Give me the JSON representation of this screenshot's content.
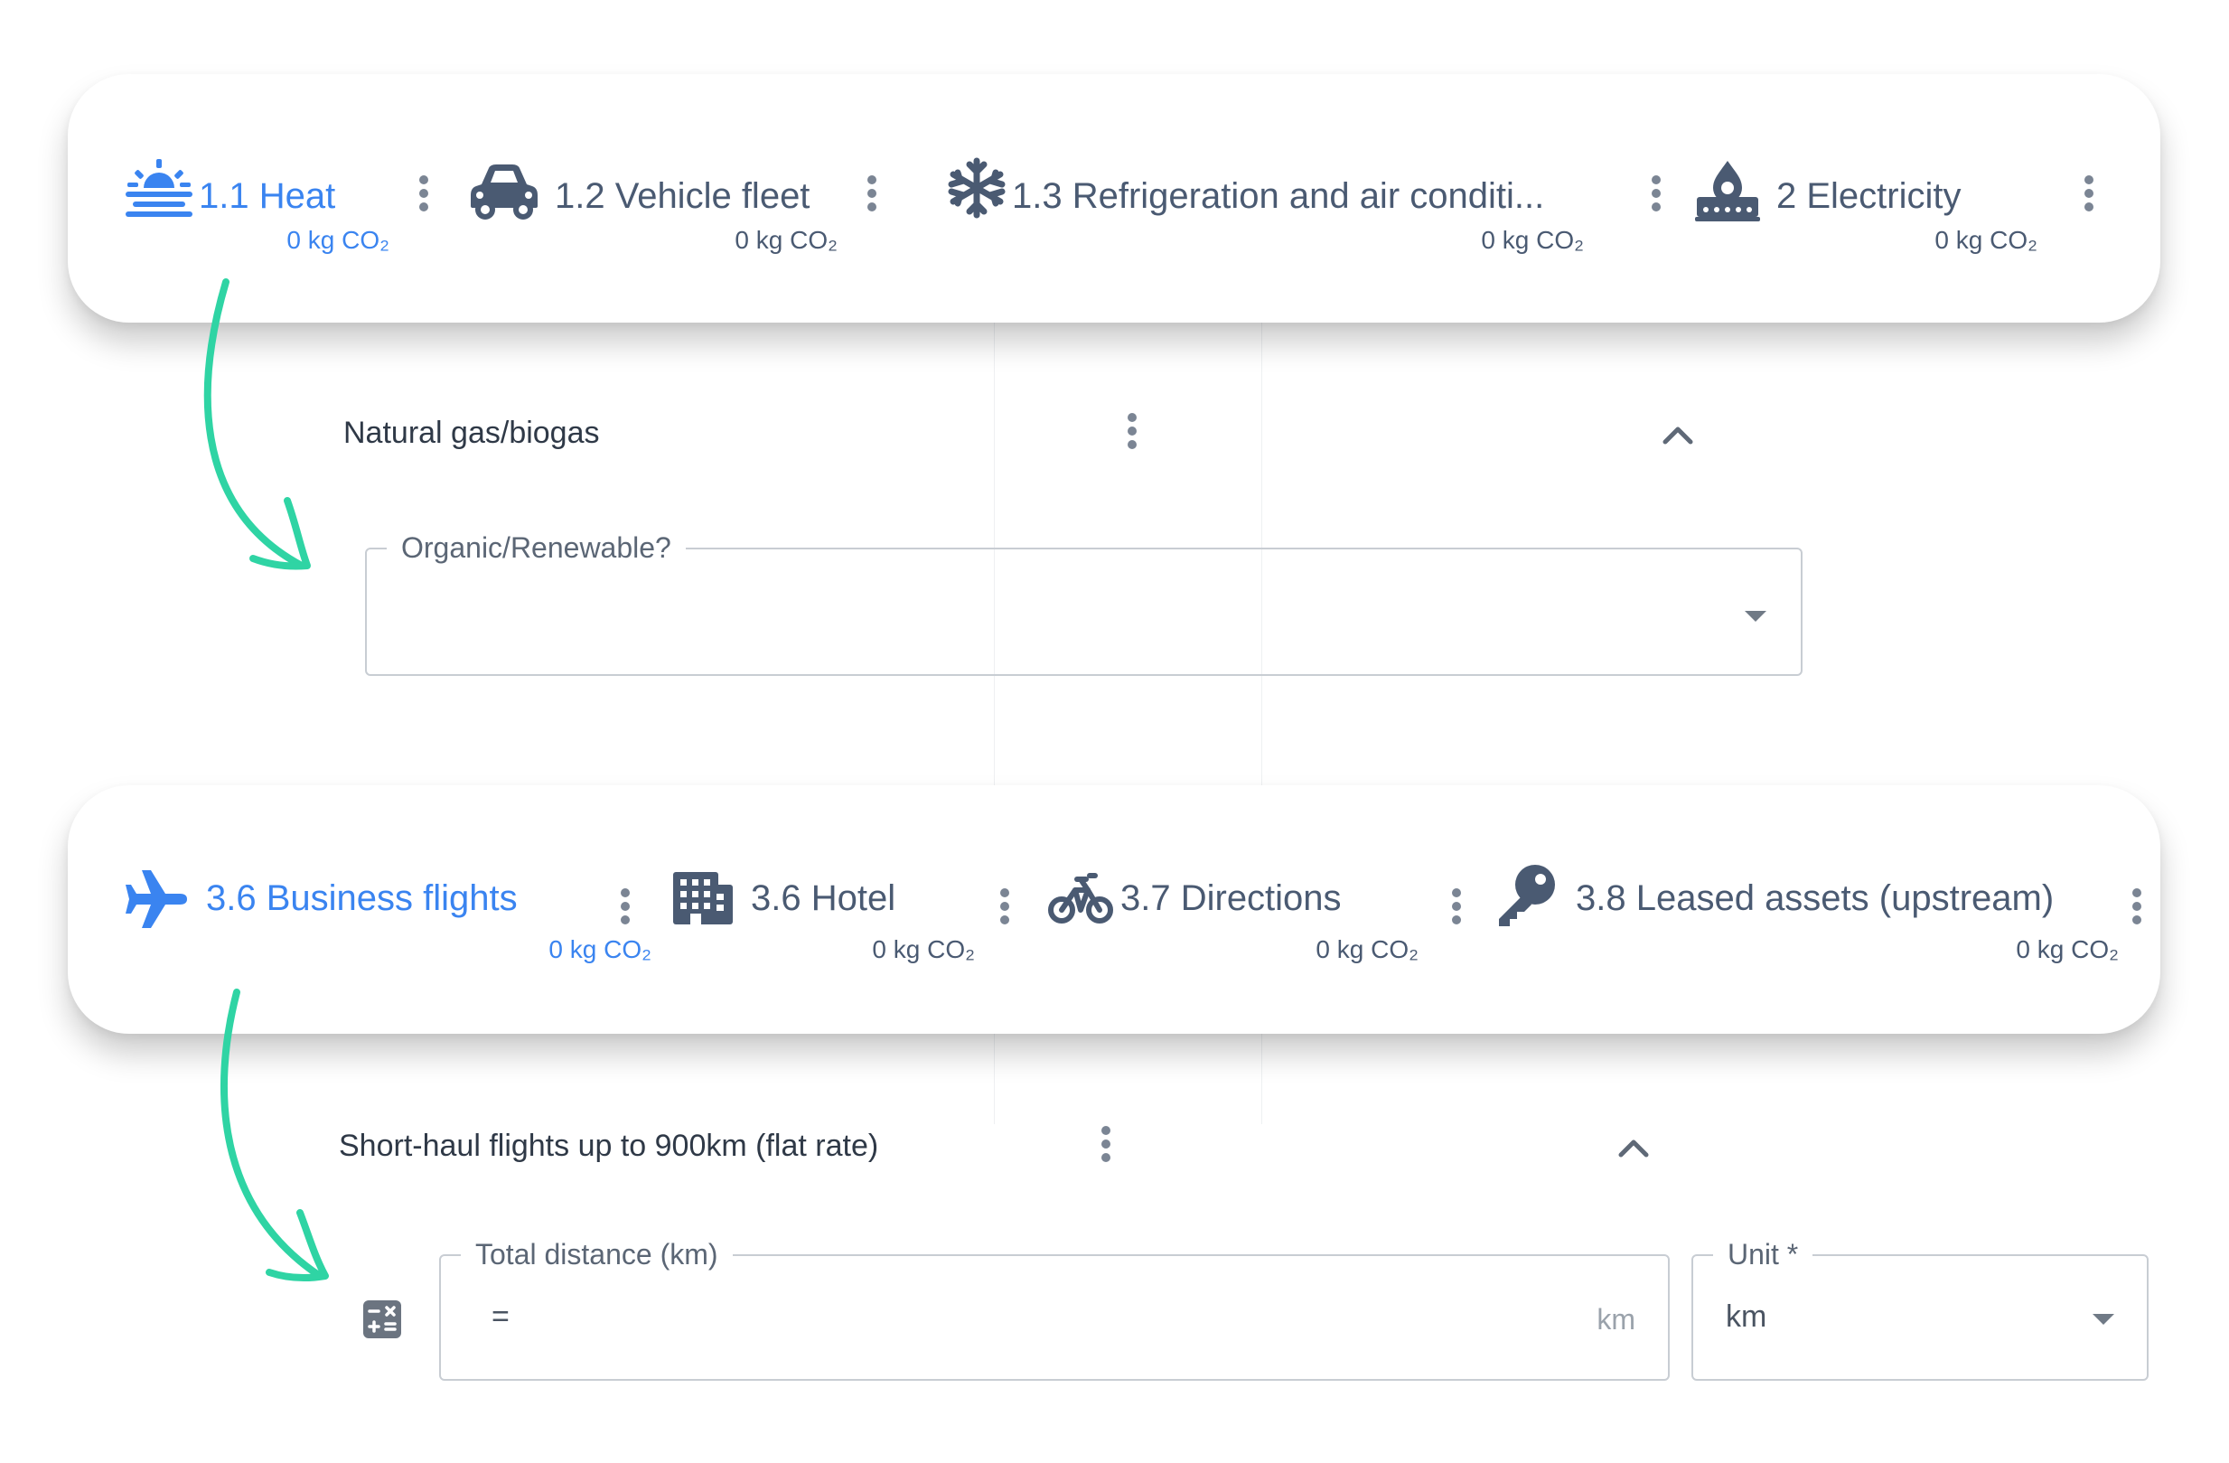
{
  "colors": {
    "active": "#3a84f0",
    "inactive": "#4a5a72",
    "arrow": "#2fd4a4"
  },
  "top_card": {
    "tabs": [
      {
        "label": "1.1 Heat",
        "emissions": "0 kg CO₂",
        "icon": "heat-icon",
        "active": true
      },
      {
        "label": "1.2 Vehicle fleet",
        "emissions": "0 kg CO₂",
        "icon": "car-icon",
        "active": false
      },
      {
        "label": "1.3 Refrigeration and air conditi...",
        "emissions": "0 kg CO₂",
        "icon": "snowflake-icon",
        "active": false
      },
      {
        "label": "2 Electricity",
        "emissions": "0 kg CO₂",
        "icon": "electricity-icon",
        "active": false
      }
    ]
  },
  "heat_section": {
    "title": "Natural gas/biogas",
    "field": {
      "label": "Organic/Renewable?",
      "value": ""
    }
  },
  "bottom_card": {
    "tabs": [
      {
        "label": "3.6 Business flights",
        "emissions": "0 kg CO₂",
        "icon": "airplane-icon",
        "active": true
      },
      {
        "label": "3.6 Hotel",
        "emissions": "0 kg CO₂",
        "icon": "hotel-icon",
        "active": false
      },
      {
        "label": "3.7 Directions",
        "emissions": "0 kg CO₂",
        "icon": "bicycle-icon",
        "active": false
      },
      {
        "label": "3.8 Leased assets (upstream)",
        "emissions": "0 kg CO₂",
        "icon": "key-icon",
        "active": false
      }
    ]
  },
  "flights_section": {
    "title": "Short-haul flights up to 900km (flat rate)",
    "distance_field": {
      "label": "Total distance (km)",
      "prefix": "=",
      "suffix": "km",
      "value": ""
    },
    "unit_field": {
      "label": "Unit *",
      "value": "km"
    }
  }
}
